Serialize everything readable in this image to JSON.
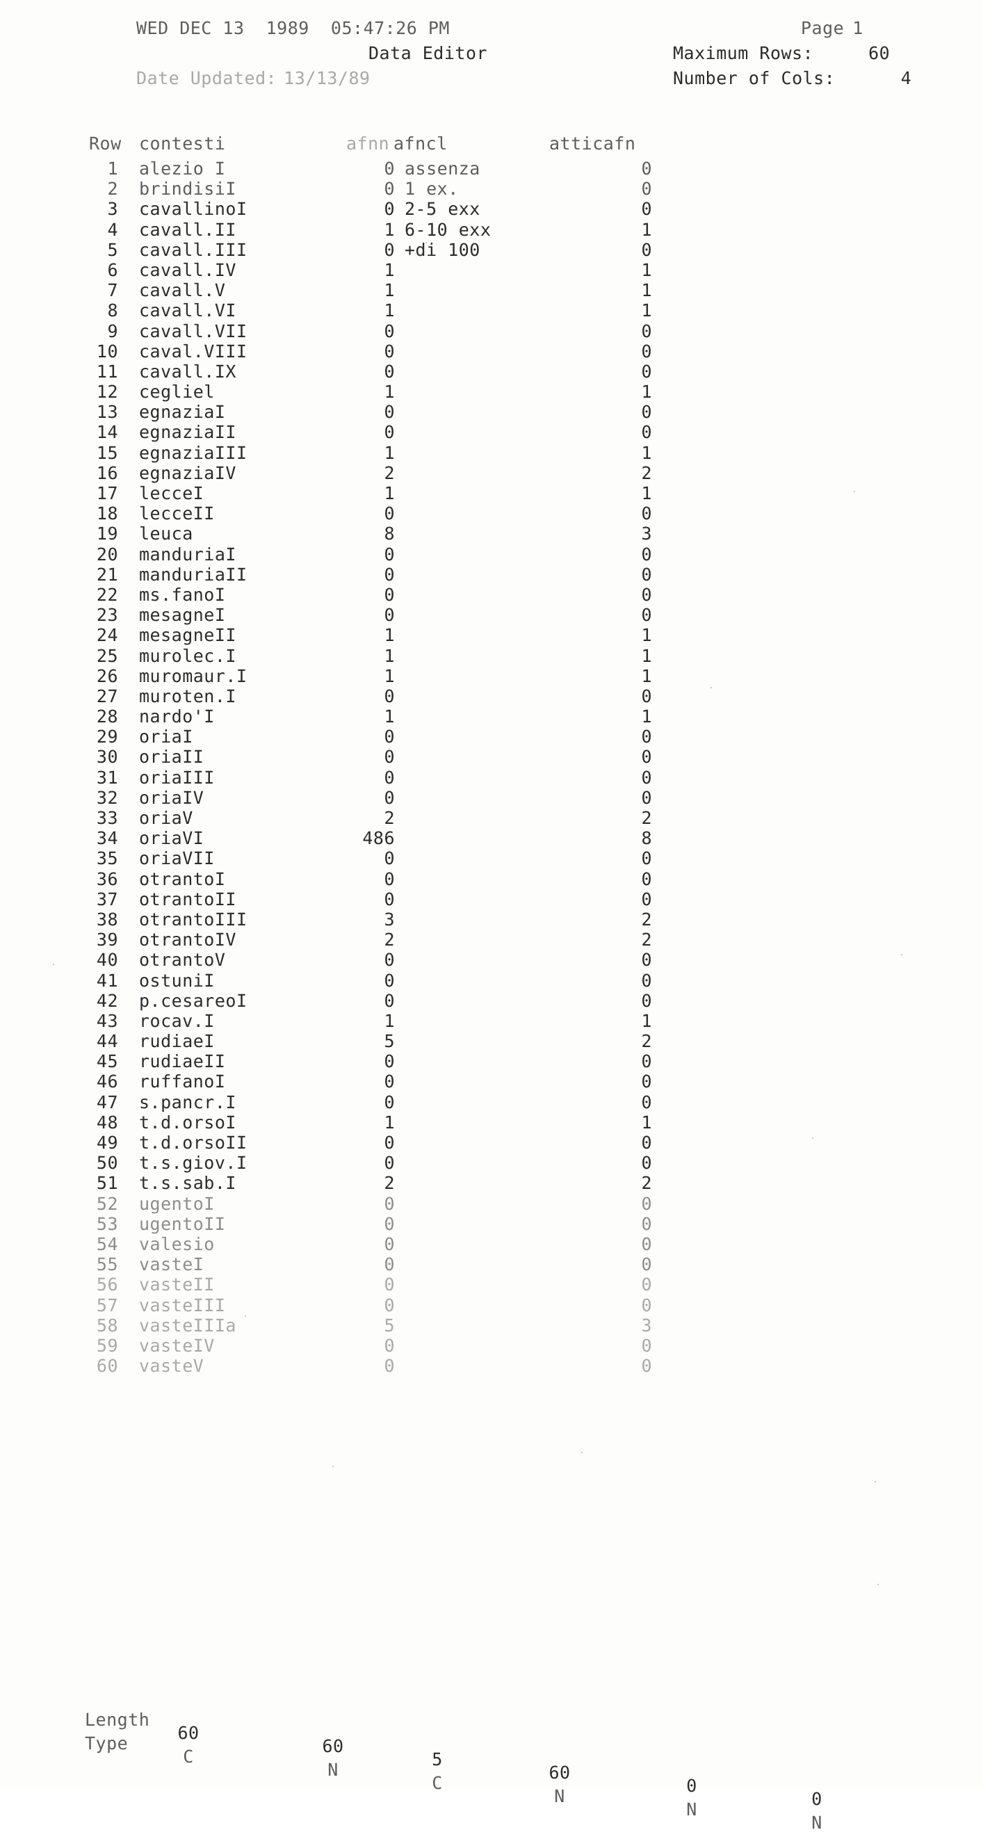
{
  "header": {
    "datetime": "WED DEC 13  1989  05:47:26 PM",
    "title": "Data Editor",
    "date_updated_label": "Date Updated:",
    "date_updated_value": "13/13/89",
    "page_label": "Page",
    "page_number": "1",
    "max_rows_label": "Maximum Rows:",
    "max_rows_value": "60",
    "num_cols_label": "Number of Cols:",
    "num_cols_value": "4"
  },
  "columns": {
    "row": "Row",
    "contesti": "contesti",
    "afnn": "afnn",
    "afncl": "afncl",
    "atticafn": "atticafn"
  },
  "rows": [
    {
      "row": "1",
      "contesti": "alezio I",
      "afnn": "0",
      "afncl": "assenza",
      "atticafn": "0"
    },
    {
      "row": "2",
      "contesti": "brindisiI",
      "afnn": "0",
      "afncl": "1 ex.",
      "atticafn": "0"
    },
    {
      "row": "3",
      "contesti": "cavallinoI",
      "afnn": "0",
      "afncl": "2-5 exx",
      "atticafn": "0"
    },
    {
      "row": "4",
      "contesti": "cavall.II",
      "afnn": "1",
      "afncl": "6-10 exx",
      "atticafn": "1"
    },
    {
      "row": "5",
      "contesti": "cavall.III",
      "afnn": "0",
      "afncl": "+di 100",
      "atticafn": "0"
    },
    {
      "row": "6",
      "contesti": "cavall.IV",
      "afnn": "1",
      "afncl": "",
      "atticafn": "1"
    },
    {
      "row": "7",
      "contesti": "cavall.V",
      "afnn": "1",
      "afncl": "",
      "atticafn": "1"
    },
    {
      "row": "8",
      "contesti": "cavall.VI",
      "afnn": "1",
      "afncl": "",
      "atticafn": "1"
    },
    {
      "row": "9",
      "contesti": "cavall.VII",
      "afnn": "0",
      "afncl": "",
      "atticafn": "0"
    },
    {
      "row": "10",
      "contesti": "caval.VIII",
      "afnn": "0",
      "afncl": "",
      "atticafn": "0"
    },
    {
      "row": "11",
      "contesti": "cavall.IX",
      "afnn": "0",
      "afncl": "",
      "atticafn": "0"
    },
    {
      "row": "12",
      "contesti": "cegliel",
      "afnn": "1",
      "afncl": "",
      "atticafn": "1"
    },
    {
      "row": "13",
      "contesti": "egnaziaI",
      "afnn": "0",
      "afncl": "",
      "atticafn": "0"
    },
    {
      "row": "14",
      "contesti": "egnaziaII",
      "afnn": "0",
      "afncl": "",
      "atticafn": "0"
    },
    {
      "row": "15",
      "contesti": "egnaziaIII",
      "afnn": "1",
      "afncl": "",
      "atticafn": "1"
    },
    {
      "row": "16",
      "contesti": "egnaziaIV",
      "afnn": "2",
      "afncl": "",
      "atticafn": "2"
    },
    {
      "row": "17",
      "contesti": "lecceI",
      "afnn": "1",
      "afncl": "",
      "atticafn": "1"
    },
    {
      "row": "18",
      "contesti": "lecceII",
      "afnn": "0",
      "afncl": "",
      "atticafn": "0"
    },
    {
      "row": "19",
      "contesti": "leuca",
      "afnn": "8",
      "afncl": "",
      "atticafn": "3"
    },
    {
      "row": "20",
      "contesti": "manduriaI",
      "afnn": "0",
      "afncl": "",
      "atticafn": "0"
    },
    {
      "row": "21",
      "contesti": "manduriaII",
      "afnn": "0",
      "afncl": "",
      "atticafn": "0"
    },
    {
      "row": "22",
      "contesti": "ms.fanoI",
      "afnn": "0",
      "afncl": "",
      "atticafn": "0"
    },
    {
      "row": "23",
      "contesti": "mesagneI",
      "afnn": "0",
      "afncl": "",
      "atticafn": "0"
    },
    {
      "row": "24",
      "contesti": "mesagneII",
      "afnn": "1",
      "afncl": "",
      "atticafn": "1"
    },
    {
      "row": "25",
      "contesti": "murolec.I",
      "afnn": "1",
      "afncl": "",
      "atticafn": "1"
    },
    {
      "row": "26",
      "contesti": "muromaur.I",
      "afnn": "1",
      "afncl": "",
      "atticafn": "1"
    },
    {
      "row": "27",
      "contesti": "muroten.I",
      "afnn": "0",
      "afncl": "",
      "atticafn": "0"
    },
    {
      "row": "28",
      "contesti": "nardo'I",
      "afnn": "1",
      "afncl": "",
      "atticafn": "1"
    },
    {
      "row": "29",
      "contesti": "oriaI",
      "afnn": "0",
      "afncl": "",
      "atticafn": "0"
    },
    {
      "row": "30",
      "contesti": "oriaII",
      "afnn": "0",
      "afncl": "",
      "atticafn": "0"
    },
    {
      "row": "31",
      "contesti": "oriaIII",
      "afnn": "0",
      "afncl": "",
      "atticafn": "0"
    },
    {
      "row": "32",
      "contesti": "oriaIV",
      "afnn": "0",
      "afncl": "",
      "atticafn": "0"
    },
    {
      "row": "33",
      "contesti": "oriaV",
      "afnn": "2",
      "afncl": "",
      "atticafn": "2"
    },
    {
      "row": "34",
      "contesti": "oriaVI",
      "afnn": "486",
      "afncl": "",
      "atticafn": "8"
    },
    {
      "row": "35",
      "contesti": "oriaVII",
      "afnn": "0",
      "afncl": "",
      "atticafn": "0"
    },
    {
      "row": "36",
      "contesti": "otrantoI",
      "afnn": "0",
      "afncl": "",
      "atticafn": "0"
    },
    {
      "row": "37",
      "contesti": "otrantoII",
      "afnn": "0",
      "afncl": "",
      "atticafn": "0"
    },
    {
      "row": "38",
      "contesti": "otrantoIII",
      "afnn": "3",
      "afncl": "",
      "atticafn": "2"
    },
    {
      "row": "39",
      "contesti": "otrantoIV",
      "afnn": "2",
      "afncl": "",
      "atticafn": "2"
    },
    {
      "row": "40",
      "contesti": "otrantoV",
      "afnn": "0",
      "afncl": "",
      "atticafn": "0"
    },
    {
      "row": "41",
      "contesti": "ostuniI",
      "afnn": "0",
      "afncl": "",
      "atticafn": "0"
    },
    {
      "row": "42",
      "contesti": "p.cesareoI",
      "afnn": "0",
      "afncl": "",
      "atticafn": "0"
    },
    {
      "row": "43",
      "contesti": "rocav.I",
      "afnn": "1",
      "afncl": "",
      "atticafn": "1"
    },
    {
      "row": "44",
      "contesti": "rudiaeI",
      "afnn": "5",
      "afncl": "",
      "atticafn": "2"
    },
    {
      "row": "45",
      "contesti": "rudiaeII",
      "afnn": "0",
      "afncl": "",
      "atticafn": "0"
    },
    {
      "row": "46",
      "contesti": "ruffanoI",
      "afnn": "0",
      "afncl": "",
      "atticafn": "0"
    },
    {
      "row": "47",
      "contesti": "s.pancr.I",
      "afnn": "0",
      "afncl": "",
      "atticafn": "0"
    },
    {
      "row": "48",
      "contesti": "t.d.orsoI",
      "afnn": "1",
      "afncl": "",
      "atticafn": "1"
    },
    {
      "row": "49",
      "contesti": "t.d.orsoII",
      "afnn": "0",
      "afncl": "",
      "atticafn": "0"
    },
    {
      "row": "50",
      "contesti": "t.s.giov.I",
      "afnn": "0",
      "afncl": "",
      "atticafn": "0"
    },
    {
      "row": "51",
      "contesti": "t.s.sab.I",
      "afnn": "2",
      "afncl": "",
      "atticafn": "2"
    },
    {
      "row": "52",
      "contesti": "ugentoI",
      "afnn": "0",
      "afncl": "",
      "atticafn": "0"
    },
    {
      "row": "53",
      "contesti": "ugentoII",
      "afnn": "0",
      "afncl": "",
      "atticafn": "0"
    },
    {
      "row": "54",
      "contesti": "valesio",
      "afnn": "0",
      "afncl": "",
      "atticafn": "0"
    },
    {
      "row": "55",
      "contesti": "vasteI",
      "afnn": "0",
      "afncl": "",
      "atticafn": "0"
    },
    {
      "row": "56",
      "contesti": "vasteII",
      "afnn": "0",
      "afncl": "",
      "atticafn": "0"
    },
    {
      "row": "57",
      "contesti": "vasteIII",
      "afnn": "0",
      "afncl": "",
      "atticafn": "0"
    },
    {
      "row": "58",
      "contesti": "vasteIIIa",
      "afnn": "5",
      "afncl": "",
      "atticafn": "3"
    },
    {
      "row": "59",
      "contesti": "vasteIV",
      "afnn": "0",
      "afncl": "",
      "atticafn": "0"
    },
    {
      "row": "60",
      "contesti": "vasteV",
      "afnn": "0",
      "afncl": "",
      "atticafn": "0"
    }
  ],
  "footer": {
    "length_label": "Length",
    "type_label": "Type",
    "lengths": [
      "60",
      "60",
      "5",
      "60",
      "0",
      "0"
    ],
    "types": [
      "C",
      "N",
      "C",
      "N",
      "N",
      "N"
    ]
  }
}
